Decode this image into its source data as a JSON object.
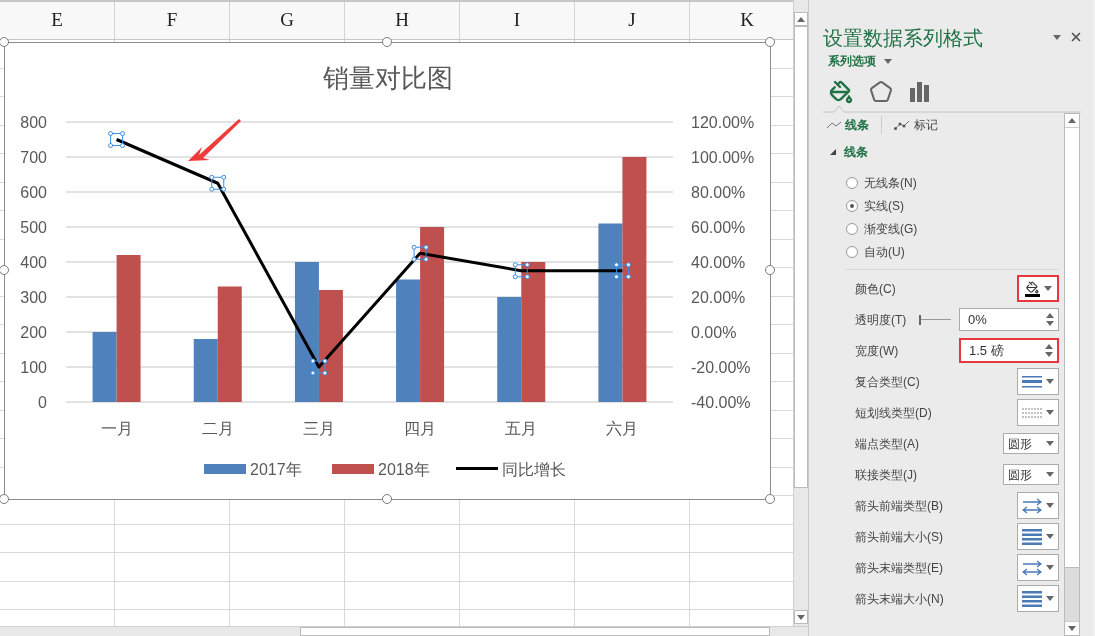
{
  "sheet": {
    "columns": [
      "E",
      "F",
      "G",
      "H",
      "I",
      "J",
      "K"
    ]
  },
  "chart": {
    "selected": true,
    "line_selected": true,
    "pointer_arrow": true,
    "chart_data": {
      "type": "bar",
      "title": "销量对比图",
      "grid": true,
      "legend": "bottom",
      "categories": [
        "一月",
        "二月",
        "三月",
        "四月",
        "五月",
        "六月"
      ],
      "series": [
        {
          "name": "2017年",
          "color": "#4f81bd",
          "type": "bar",
          "values": [
            200,
            180,
            400,
            350,
            300,
            510
          ]
        },
        {
          "name": "2018年",
          "color": "#c0504d",
          "type": "bar",
          "values": [
            420,
            330,
            320,
            500,
            400,
            700
          ]
        },
        {
          "name": "同比增长",
          "color": "#000000",
          "type": "line",
          "axis": "y2",
          "marker": "square",
          "values": [
            1.1,
            0.85,
            -0.2,
            0.45,
            0.35,
            0.35
          ]
        }
      ],
      "ylim": [
        0,
        800
      ],
      "yticks": [
        0,
        100,
        200,
        300,
        400,
        500,
        600,
        700,
        800
      ],
      "y2lim": [
        -0.4,
        1.2
      ],
      "y2ticks": [
        {
          "value": -0.4,
          "label": "-40.00%"
        },
        {
          "value": -0.2,
          "label": "-20.00%"
        },
        {
          "value": 0,
          "label": "0.00%"
        },
        {
          "value": 0.2,
          "label": "20.00%"
        },
        {
          "value": 0.4,
          "label": "40.00%"
        },
        {
          "value": 0.6,
          "label": "60.00%"
        },
        {
          "value": 0.8,
          "label": "80.00%"
        },
        {
          "value": 1.0,
          "label": "100.00%"
        },
        {
          "value": 1.2,
          "label": "120.00%"
        }
      ]
    }
  },
  "panel": {
    "title": "设置数据系列格式",
    "options_dropdown": "系列选项",
    "icon_tabs": [
      {
        "kind": "fill",
        "selected": true
      },
      {
        "kind": "effects",
        "selected": false
      },
      {
        "kind": "series",
        "selected": false
      }
    ],
    "sub_tabs": [
      {
        "kind": "line",
        "label": "线条",
        "selected": true
      },
      {
        "kind": "marker",
        "label": "标记",
        "selected": false
      }
    ],
    "section": {
      "label": "线条",
      "expanded": true
    },
    "line_options": [
      {
        "label": "无线条(N)",
        "selected": false
      },
      {
        "label": "实线(S)",
        "selected": true
      },
      {
        "label": "渐变线(G)",
        "selected": false
      },
      {
        "label": "自动(U)",
        "selected": false
      }
    ],
    "properties": [
      {
        "kind": "color",
        "label": "颜色(C)",
        "highlighted": true
      },
      {
        "kind": "slider",
        "label": "透明度(T)",
        "level": 0,
        "value": "0%",
        "highlighted": false
      },
      {
        "kind": "spin",
        "label": "宽度(W)",
        "value": "1.5 磅",
        "highlighted": true
      },
      {
        "kind": "compound",
        "label": "复合类型(C)",
        "highlighted": false
      },
      {
        "kind": "dash",
        "label": "短划线类型(D)",
        "highlighted": false
      },
      {
        "kind": "select",
        "label": "端点类型(A)",
        "value": "圆形",
        "highlighted": false
      },
      {
        "kind": "select",
        "label": "联接类型(J)",
        "value": "圆形",
        "highlighted": false
      },
      {
        "kind": "arrow_type",
        "label": "箭头前端类型(B)",
        "highlighted": false
      },
      {
        "kind": "arrow_size",
        "label": "箭头前端大小(S)",
        "highlighted": false
      },
      {
        "kind": "arrow_type",
        "label": "箭头末端类型(E)",
        "highlighted": false
      },
      {
        "kind": "arrow_size",
        "label": "箭头末端大小(N)",
        "highlighted": false
      }
    ]
  }
}
